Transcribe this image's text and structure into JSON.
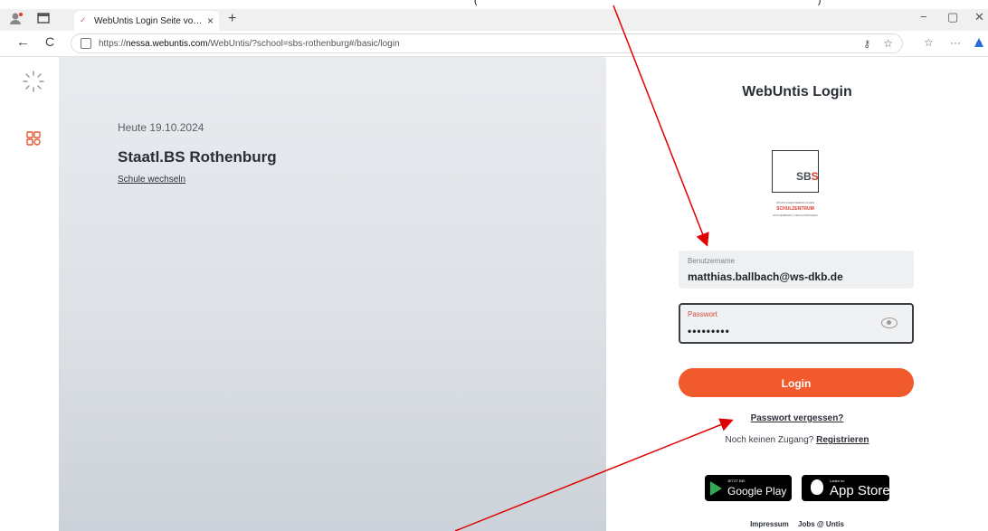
{
  "browser": {
    "tab_title": "WebUntis Login Seite von Staatl.B",
    "url_prefix": "https://",
    "url_host": "nessa.webuntis.com",
    "url_rest": "/WebUntis/?school=sbs-rothenburg#/basic/login",
    "new_tab": "+",
    "back": "←",
    "reload": "C",
    "minimize": "−",
    "restore": "▢",
    "close": "✕",
    "more": "···",
    "tab_close": "×"
  },
  "left": {
    "date": "Heute 19.10.2024",
    "school_name": "Staatl.BS Rothenburg",
    "change_school": "Schule wechseln"
  },
  "login": {
    "title": "WebUntis Login",
    "logo_text_a": "SB",
    "logo_text_b": "S",
    "logo_tagline_main": "SCHULZENTRUM",
    "logo_tagline_small_top": "STAATLICHES BERUFLICHES",
    "logo_tagline_small_bottom": "ROTHENBURG | FEUCHTWANGEN",
    "username_label": "Benutzername",
    "username_value": "matthias.ballbach@ws-dkb.de",
    "password_label": "Passwort",
    "password_value": "•••••••••",
    "login_button": "Login",
    "forgot_password": "Passwort vergessen?",
    "no_access": "Noch keinen Zugang?",
    "register": "Registrieren"
  },
  "stores": {
    "google_small": "JETZT BEI",
    "google_big": "Google Play",
    "apple_small": "Laden im",
    "apple_big": "App Store"
  },
  "footer": {
    "impressum": "Impressum",
    "jobs": "Jobs @ Untis"
  },
  "annotation": {
    "cut_text_left": "(",
    "cut_text_right": ")",
    "arrow_color": "#e00000"
  }
}
